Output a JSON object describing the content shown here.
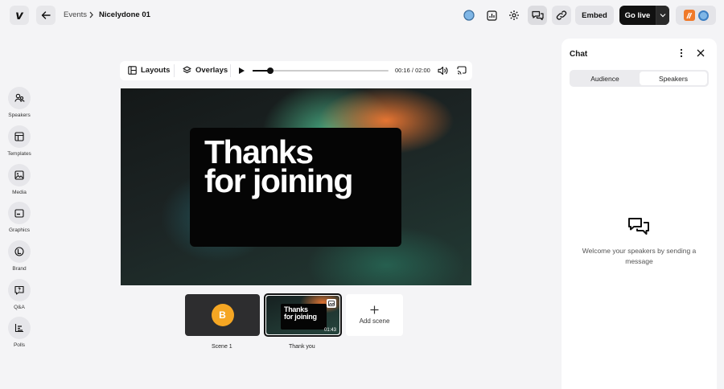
{
  "header": {
    "breadcrumb_parent": "Events",
    "breadcrumb_current": "Nicelydone 01",
    "embed_label": "Embed",
    "golive_label": "Go live"
  },
  "sidebar": {
    "items": [
      {
        "label": "Speakers",
        "icon": "speakers-icon"
      },
      {
        "label": "Templates",
        "icon": "templates-icon"
      },
      {
        "label": "Media",
        "icon": "media-icon"
      },
      {
        "label": "Graphics",
        "icon": "graphics-icon"
      },
      {
        "label": "Brand",
        "icon": "brand-icon"
      },
      {
        "label": "Q&A",
        "icon": "qa-icon"
      },
      {
        "label": "Polls",
        "icon": "polls-icon"
      }
    ]
  },
  "stage_toolbar": {
    "layouts_label": "Layouts",
    "overlays_label": "Overlays",
    "current_time": "00:16",
    "time_separator": "/",
    "duration": "02:00",
    "progress_fraction": 0.133
  },
  "stage": {
    "line1": "Thanks",
    "line2": "for joining"
  },
  "scenes": [
    {
      "label": "Scene 1",
      "avatar_letter": "B"
    },
    {
      "label": "Thank you",
      "thumb_line1": "Thanks",
      "thumb_line2": "for joining",
      "duration": "01:43",
      "selected": true
    }
  ],
  "add_scene_label": "Add scene",
  "chat": {
    "title": "Chat",
    "tabs": [
      {
        "label": "Audience",
        "active": false
      },
      {
        "label": "Speakers",
        "active": true
      }
    ],
    "empty_message": "Welcome your speakers by sending a message"
  },
  "colors": {
    "accent_dark": "#111111",
    "avatar_orange": "#f5a623",
    "live_orange": "#f07a2a"
  }
}
